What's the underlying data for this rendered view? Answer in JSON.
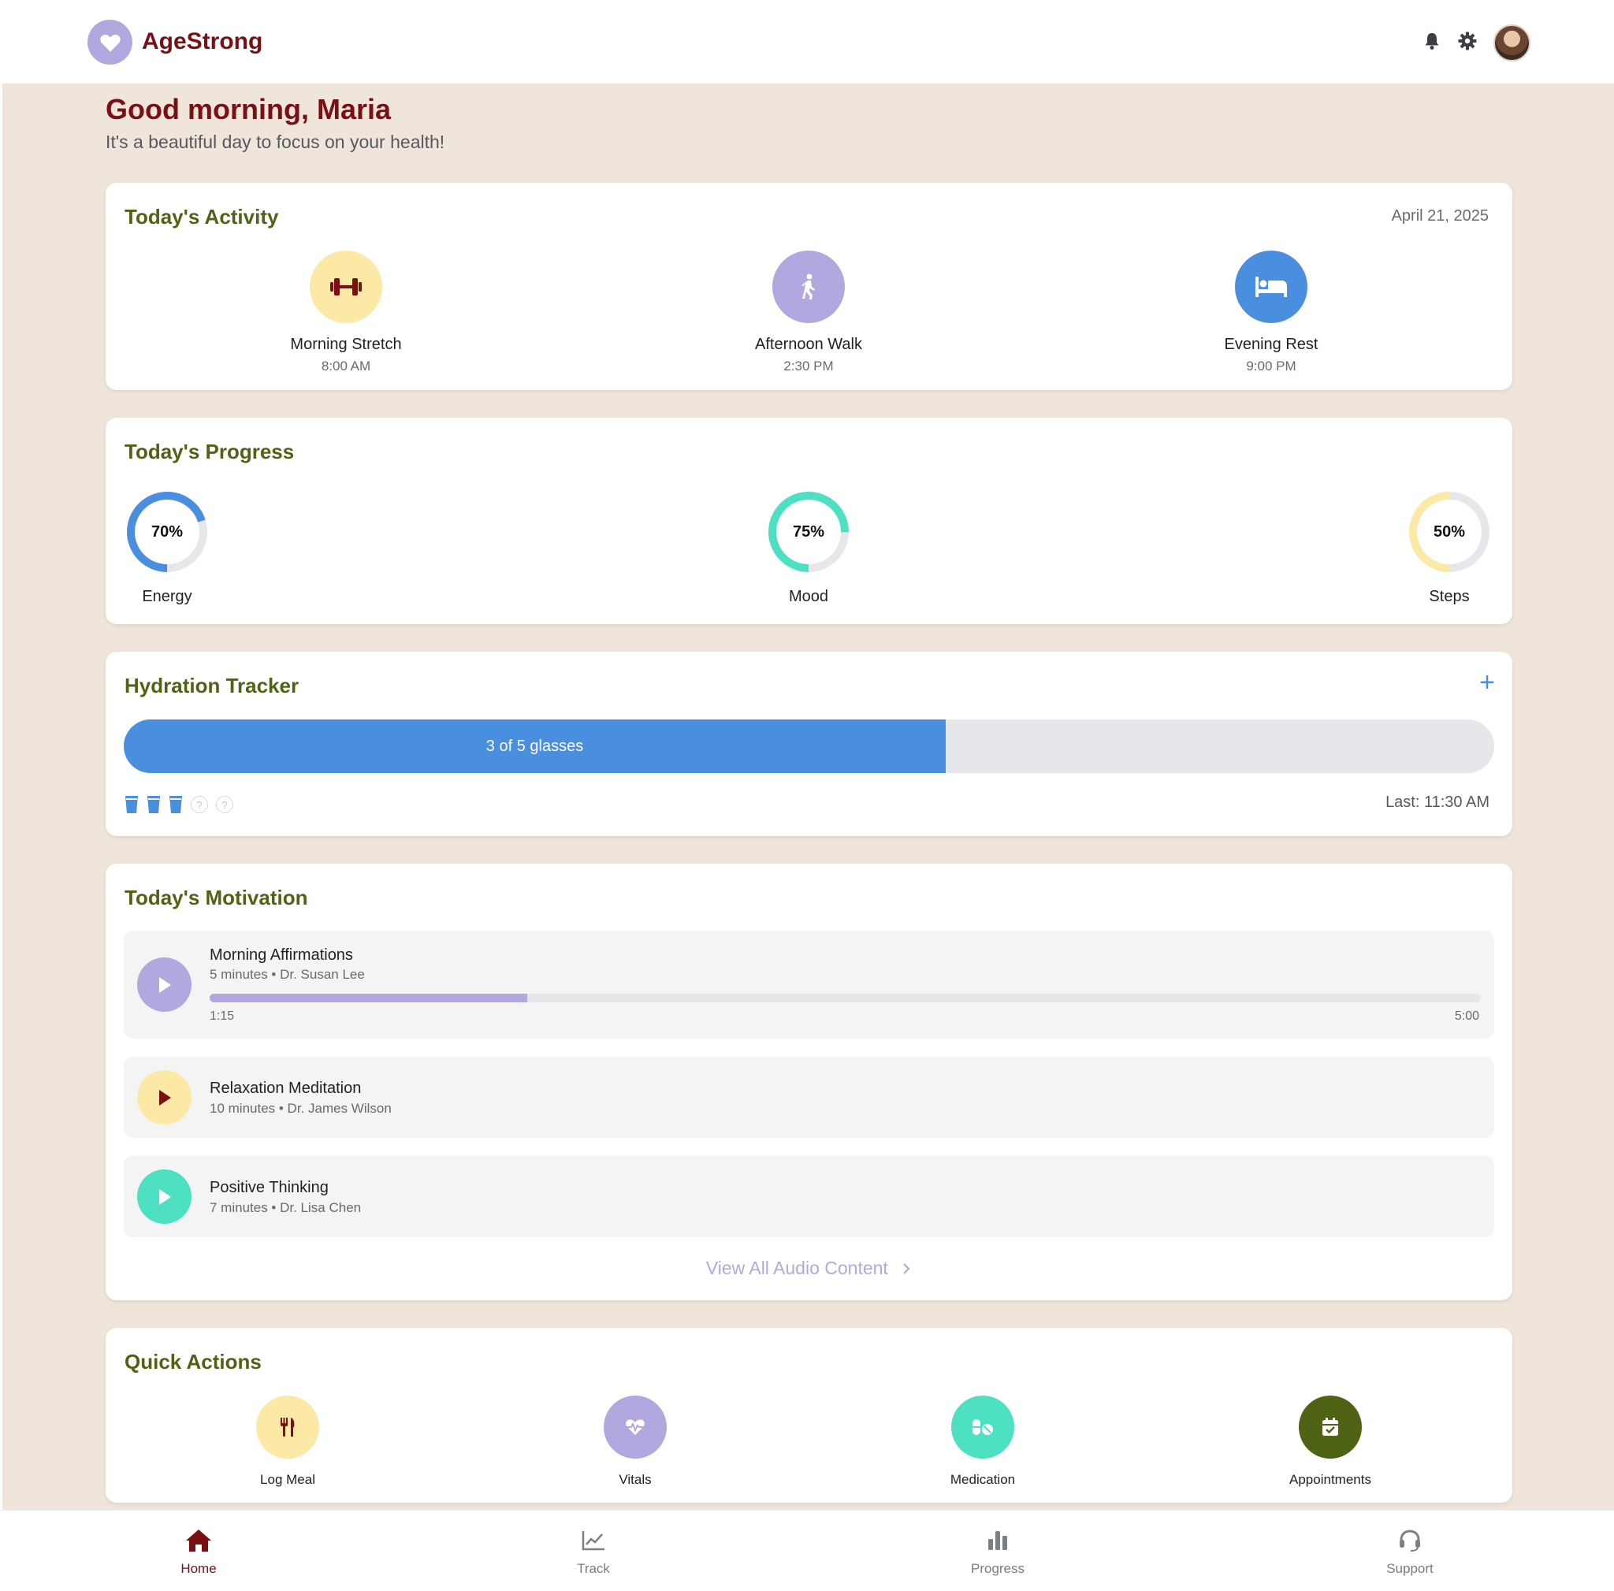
{
  "app": {
    "name": "AgeStrong"
  },
  "header": {
    "icons": [
      "heart-icon",
      "bell-icon",
      "gear-icon",
      "avatar"
    ]
  },
  "greeting": {
    "title": "Good morning, Maria",
    "subtitle": "It's a beautiful day to focus on your health!"
  },
  "activity": {
    "title": "Today's Activity",
    "date": "April 21, 2025",
    "items": [
      {
        "name": "Morning Stretch",
        "time": "8:00 AM",
        "icon": "dumbbell-icon",
        "color": "#fde9a6"
      },
      {
        "name": "Afternoon Walk",
        "time": "2:30 PM",
        "icon": "walking-icon",
        "color": "#b3a7e0"
      },
      {
        "name": "Evening Rest",
        "time": "9:00 PM",
        "icon": "bed-icon",
        "color": "#4a8ee0"
      }
    ]
  },
  "progress": {
    "title": "Today's Progress",
    "items": [
      {
        "label": "Energy",
        "value_text": "70%",
        "value": 70,
        "color": "#4a8ee0"
      },
      {
        "label": "Mood",
        "value_text": "75%",
        "value": 75,
        "color": "#4ee0c2"
      },
      {
        "label": "Steps",
        "value_text": "50%",
        "value": 50,
        "color": "#fde9a6"
      }
    ]
  },
  "hydration": {
    "title": "Hydration Tracker",
    "add_label": "+",
    "bar_text": "3 of 5 glasses",
    "filled": 3,
    "total": 5,
    "empty_glyph": "?",
    "last": "Last: 11:30 AM"
  },
  "motivation": {
    "title": "Today's Motivation",
    "tracks": [
      {
        "title": "Morning Affirmations",
        "sub": "5 minutes • Dr. Susan Lee",
        "current": "1:15",
        "duration": "5:00",
        "progress": 0.25,
        "color": "#b3a7e0",
        "icon_color": "#ffffff"
      },
      {
        "title": "Relaxation Meditation",
        "sub": "10 minutes • Dr. James Wilson",
        "color": "#fde9a6",
        "icon_color": "#7a0f14"
      },
      {
        "title": "Positive Thinking",
        "sub": "7 minutes • Dr. Lisa Chen",
        "color": "#4ee0c2",
        "icon_color": "#ffffff"
      }
    ],
    "view_all": "View All Audio Content",
    "view_all_icon": "chevron-right-icon"
  },
  "quick_actions": {
    "title": "Quick Actions",
    "items": [
      {
        "label": "Log Meal",
        "icon": "utensils-icon",
        "color": "#fde9a6"
      },
      {
        "label": "Vitals",
        "icon": "heart-pulse-icon",
        "color": "#b3a7e0"
      },
      {
        "label": "Medication",
        "icon": "pills-icon",
        "color": "#4ee0c2"
      },
      {
        "label": "Appointments",
        "icon": "calendar-check-icon",
        "color": "#4f6314"
      }
    ]
  },
  "nav": {
    "items": [
      {
        "label": "Home",
        "icon": "home-icon",
        "active": true
      },
      {
        "label": "Track",
        "icon": "line-chart-icon",
        "active": false
      },
      {
        "label": "Progress",
        "icon": "bar-chart-icon",
        "active": false
      },
      {
        "label": "Support",
        "icon": "headset-icon",
        "active": false
      }
    ]
  },
  "colors": {
    "brand": "#7a0f14",
    "section_title": "#4f6314",
    "accent_blue": "#4a8ee0",
    "lavender": "#b3a7e0",
    "mint": "#4ee0c2",
    "butter": "#fde9a6",
    "background": "#efe5da"
  }
}
